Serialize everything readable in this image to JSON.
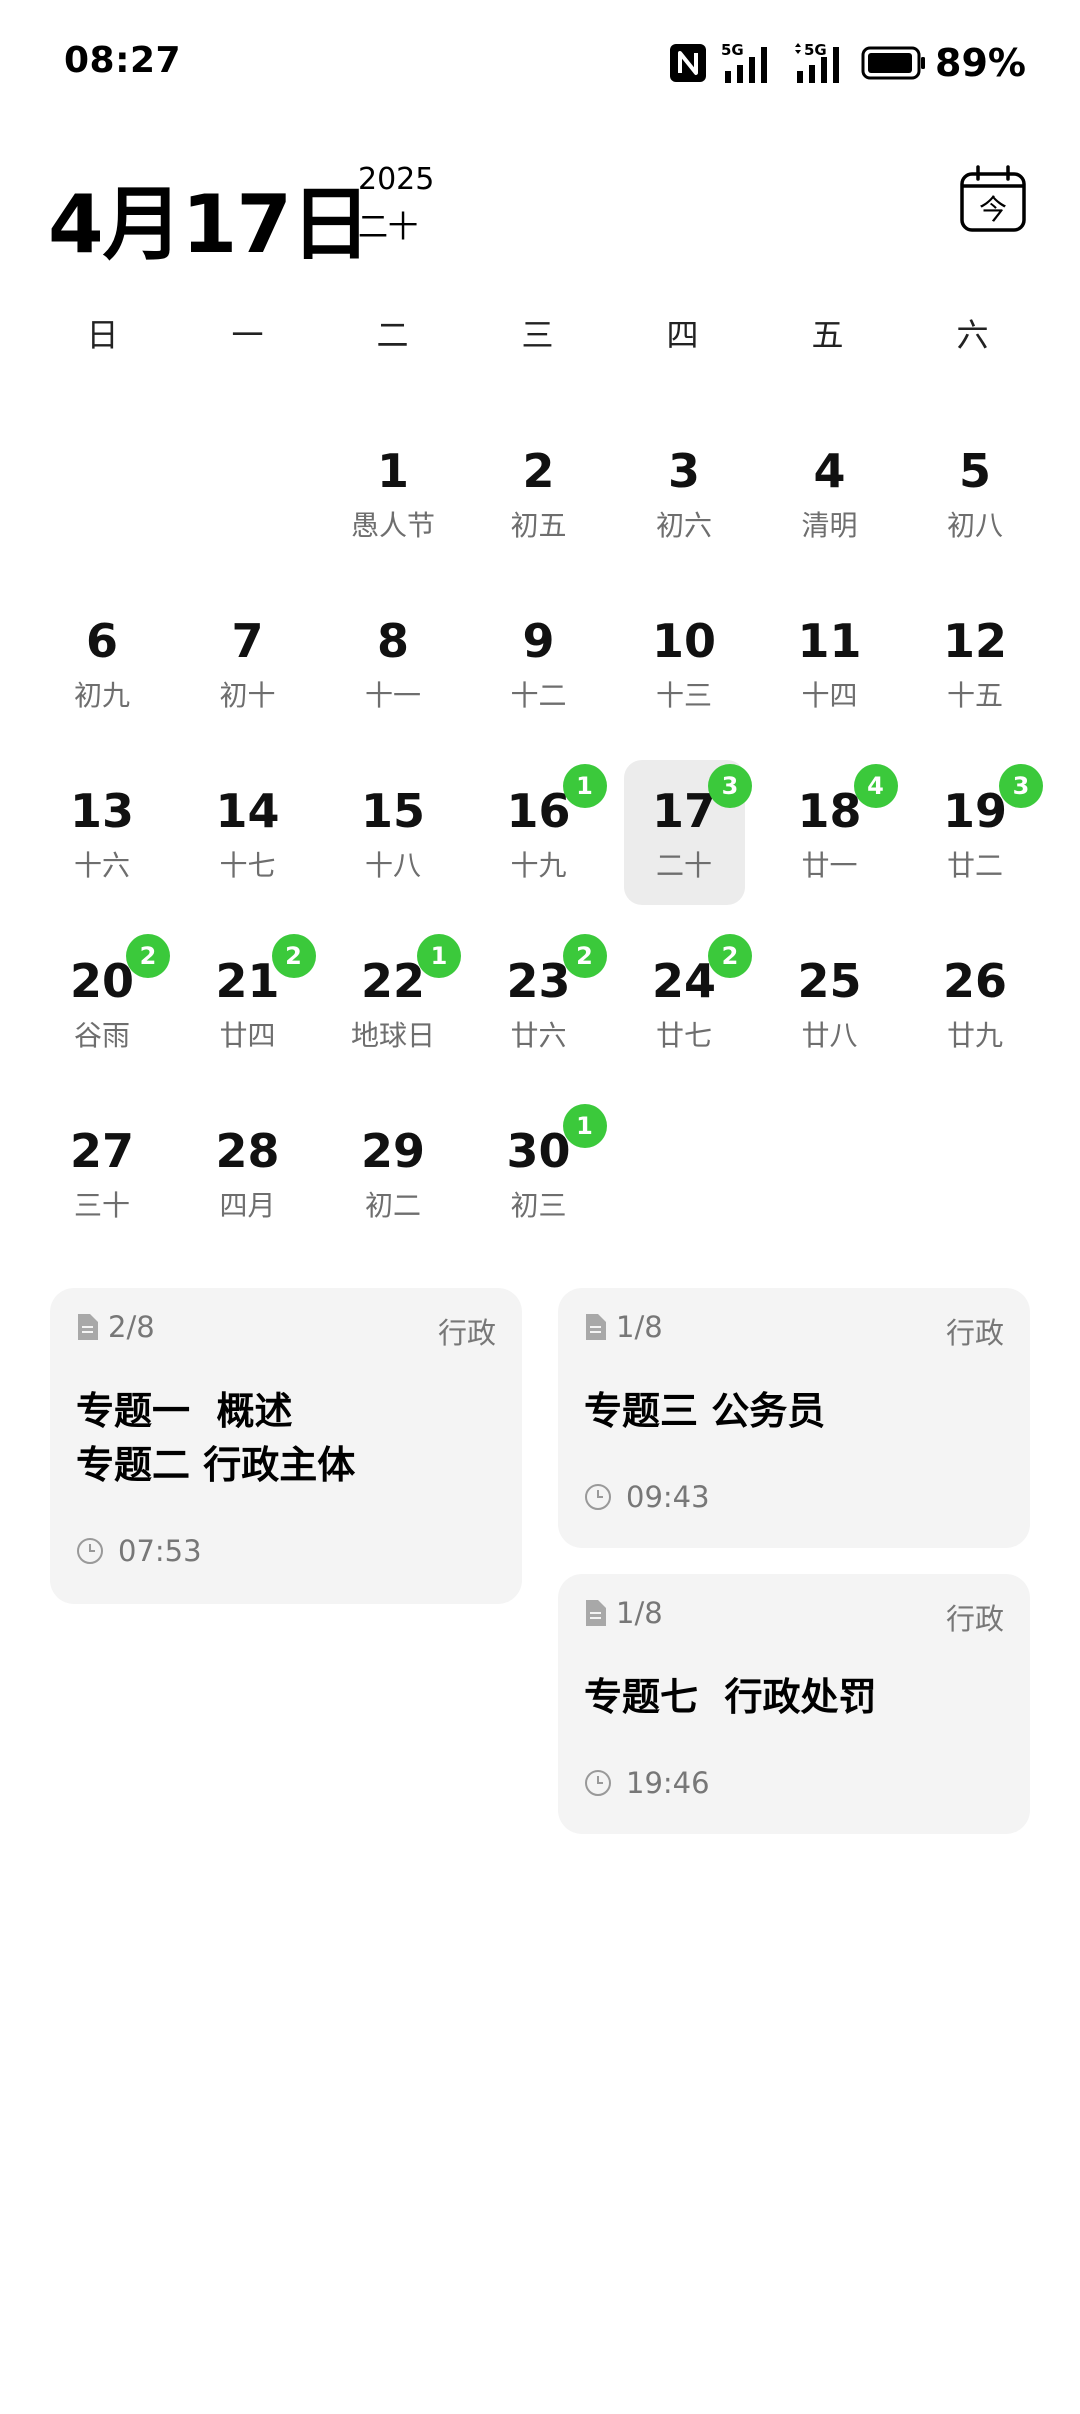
{
  "status_bar": {
    "time": "08:27",
    "battery": "89%",
    "icons": [
      "nfc-icon",
      "signal-5g-icon",
      "signal-5g-data-icon",
      "battery-icon"
    ]
  },
  "header": {
    "date": "4月17日",
    "year": "2025",
    "lunar": "二十",
    "today_button_glyph": "今"
  },
  "weekdays": [
    "日",
    "一",
    "二",
    "三",
    "四",
    "五",
    "六"
  ],
  "calendar": {
    "month_days": [
      {
        "day": "1",
        "lunar": "愚人节"
      },
      {
        "day": "2",
        "lunar": "初五"
      },
      {
        "day": "3",
        "lunar": "初六"
      },
      {
        "day": "4",
        "lunar": "清明"
      },
      {
        "day": "5",
        "lunar": "初八"
      },
      {
        "day": "6",
        "lunar": "初九"
      },
      {
        "day": "7",
        "lunar": "初十"
      },
      {
        "day": "8",
        "lunar": "十一"
      },
      {
        "day": "9",
        "lunar": "十二"
      },
      {
        "day": "10",
        "lunar": "十三"
      },
      {
        "day": "11",
        "lunar": "十四"
      },
      {
        "day": "12",
        "lunar": "十五"
      },
      {
        "day": "13",
        "lunar": "十六"
      },
      {
        "day": "14",
        "lunar": "十七"
      },
      {
        "day": "15",
        "lunar": "十八"
      },
      {
        "day": "16",
        "lunar": "十九",
        "badge": "1"
      },
      {
        "day": "17",
        "lunar": "二十",
        "badge": "3",
        "selected": true
      },
      {
        "day": "18",
        "lunar": "廿一",
        "badge": "4"
      },
      {
        "day": "19",
        "lunar": "廿二",
        "badge": "3"
      },
      {
        "day": "20",
        "lunar": "谷雨",
        "badge": "2"
      },
      {
        "day": "21",
        "lunar": "廿四",
        "badge": "2"
      },
      {
        "day": "22",
        "lunar": "地球日",
        "badge": "1"
      },
      {
        "day": "23",
        "lunar": "廿六",
        "badge": "2"
      },
      {
        "day": "24",
        "lunar": "廿七",
        "badge": "2"
      },
      {
        "day": "25",
        "lunar": "廿八"
      },
      {
        "day": "26",
        "lunar": "廿九"
      },
      {
        "day": "27",
        "lunar": "三十"
      },
      {
        "day": "28",
        "lunar": "四月"
      },
      {
        "day": "29",
        "lunar": "初二"
      },
      {
        "day": "30",
        "lunar": "初三",
        "badge": "1"
      }
    ],
    "badge_color": "#3bc93b",
    "selected_bg": "#ececec"
  },
  "cards": [
    {
      "count": "2/8",
      "tag": "行政",
      "title": "专题一  概述\n专题二 行政主体",
      "time": "07:53"
    },
    {
      "count": "1/8",
      "tag": "行政",
      "title": "专题三 公务员",
      "time": "09:43"
    },
    {
      "count": "1/8",
      "tag": "行政",
      "title": "专题七  行政处罚",
      "time": "19:46"
    }
  ]
}
